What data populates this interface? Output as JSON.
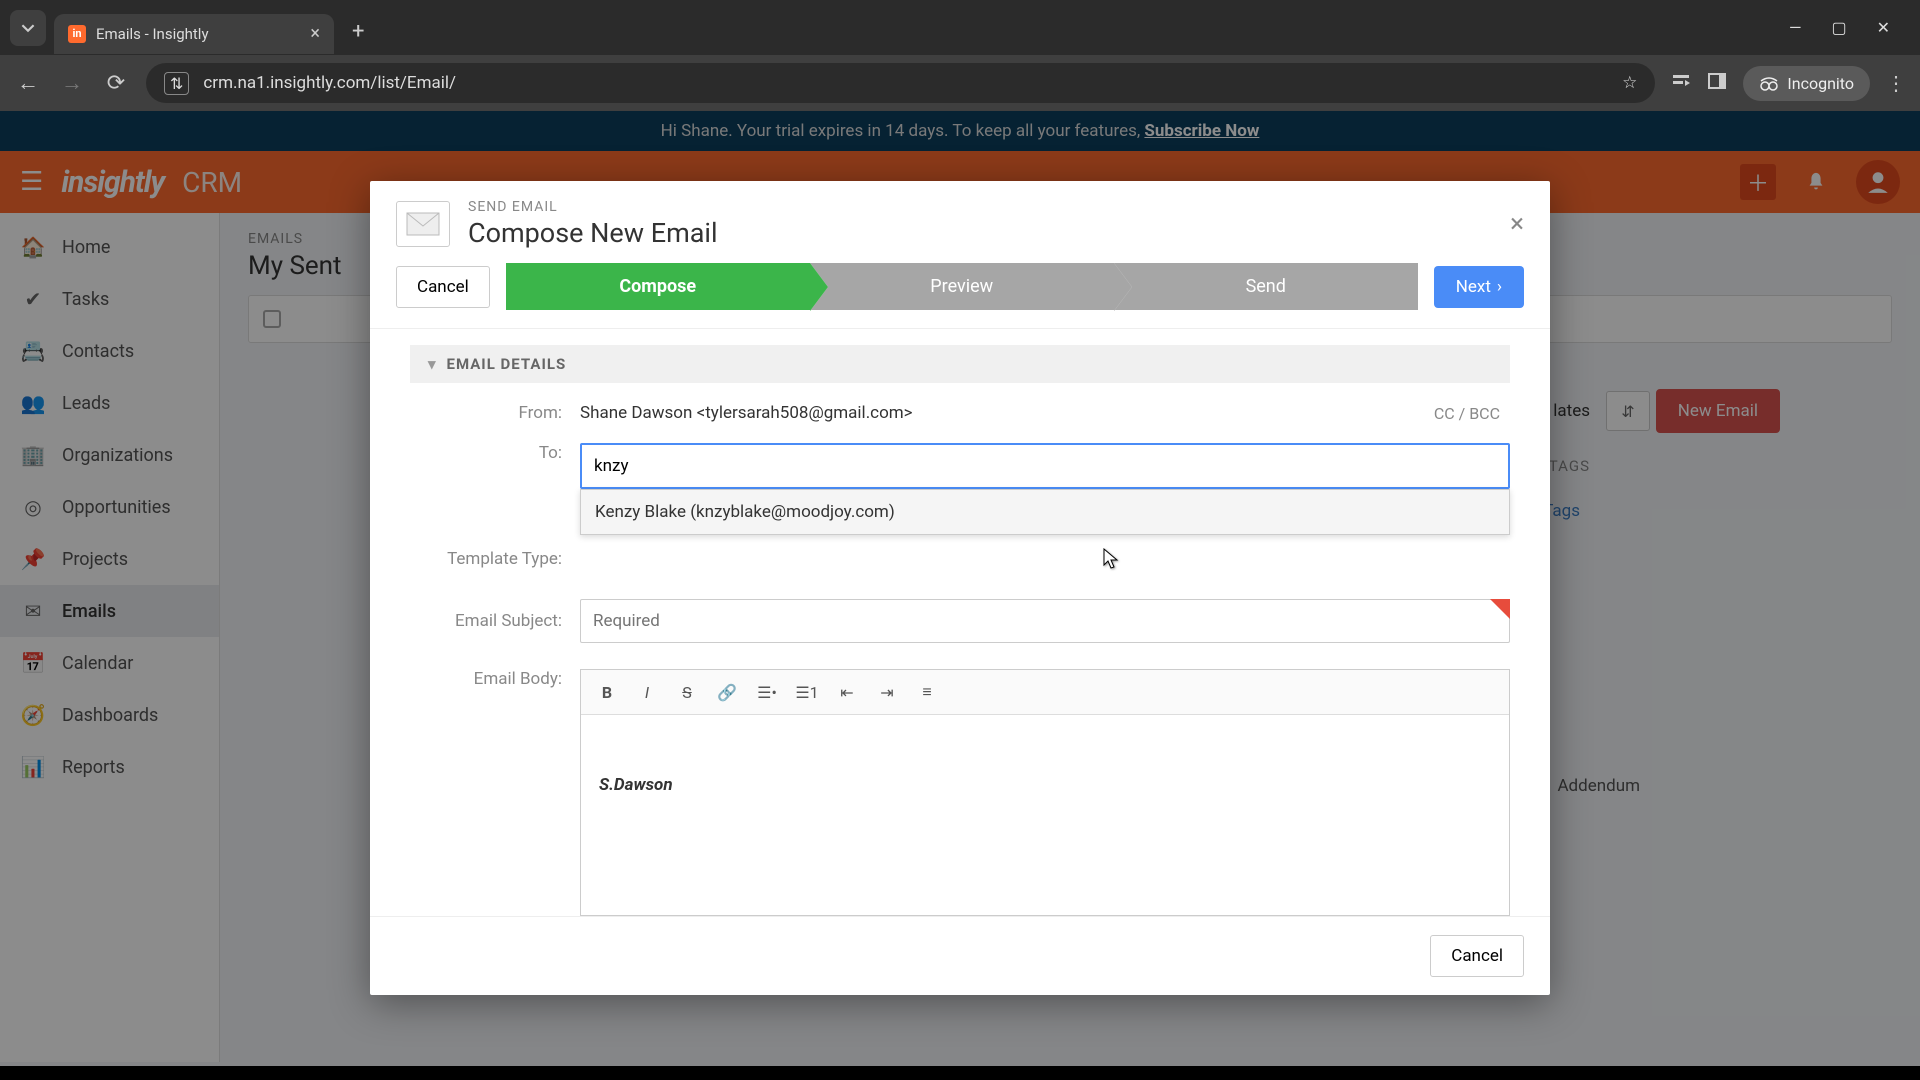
{
  "browser": {
    "tab_title": "Emails - Insightly",
    "url": "crm.na1.insightly.com/list/Email/",
    "incognito": "Incognito"
  },
  "banner": {
    "prefix": "Hi Shane. Your trial expires in 14 days. To keep all your features, ",
    "link": "Subscribe Now"
  },
  "topbar": {
    "logo": "insightly",
    "product": "CRM"
  },
  "sidebar": {
    "items": [
      {
        "label": "Home",
        "icon": "⌂"
      },
      {
        "label": "Tasks",
        "icon": "✔"
      },
      {
        "label": "Contacts",
        "icon": "▤"
      },
      {
        "label": "Leads",
        "icon": "👥"
      },
      {
        "label": "Organizations",
        "icon": "🏢"
      },
      {
        "label": "Opportunities",
        "icon": "◎"
      },
      {
        "label": "Projects",
        "icon": "⟙"
      },
      {
        "label": "Emails",
        "icon": "✉"
      },
      {
        "label": "Calendar",
        "icon": "▦"
      },
      {
        "label": "Dashboards",
        "icon": "◔"
      },
      {
        "label": "Reports",
        "icon": "📊"
      }
    ]
  },
  "page": {
    "breadcrumb": "EMAILS",
    "title": "My Sent",
    "new_email_btn": "New Email",
    "templates_peek": "lates",
    "tags_label": "L TAGS",
    "no_tags": "lo Tags",
    "addendum": "Addendum"
  },
  "modal": {
    "subtitle": "SEND EMAIL",
    "title": "Compose New Email",
    "cancel": "Cancel",
    "steps": {
      "compose": "Compose",
      "preview": "Preview",
      "send": "Send"
    },
    "next": "Next",
    "section": "EMAIL DETAILS",
    "from_label": "From:",
    "from_value": "Shane Dawson <tylersarah508@gmail.com>",
    "cc_bcc": "CC / BCC",
    "to_label": "To:",
    "to_value": "knzy",
    "suggestion": "Kenzy Blake (knzyblake@moodjoy.com)",
    "template_label": "Template Type:",
    "subject_label": "Email Subject:",
    "subject_placeholder": "Required",
    "body_label": "Email Body:",
    "signature": "S.Dawson",
    "footer_cancel": "Cancel"
  }
}
